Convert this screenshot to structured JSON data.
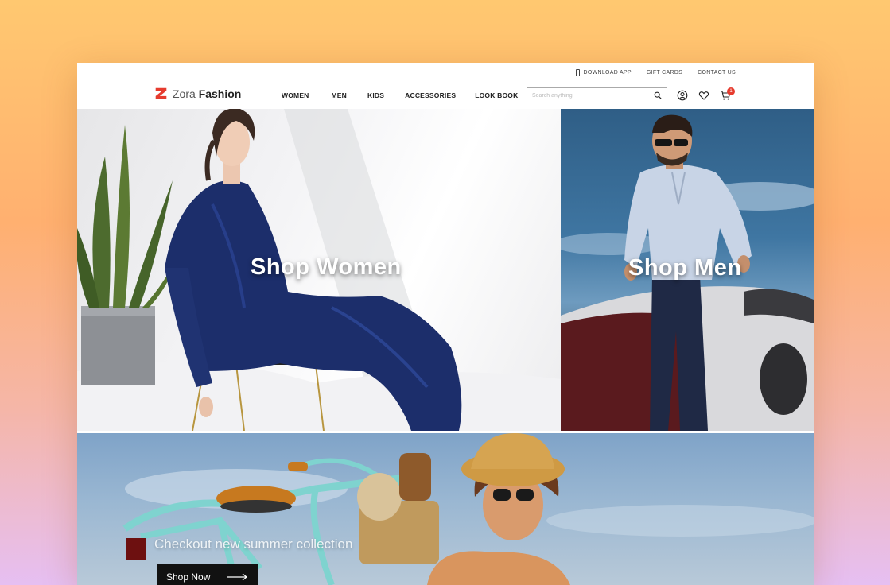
{
  "utility": {
    "download_app": "DOWNLOAD APP",
    "gift_cards": "GIFT CARDS",
    "contact_us": "CONTACT US"
  },
  "logo": {
    "light": "Zora",
    "bold": "Fashion"
  },
  "nav": {
    "women": "WOMEN",
    "men": "MEN",
    "kids": "KIDS",
    "accessories": "ACCESSORIES",
    "look_book": "LOOK BOOK"
  },
  "search": {
    "placeholder": "Search anything"
  },
  "cart": {
    "count": "1"
  },
  "hero": {
    "women_title": "Shop Women",
    "men_title": "Shop Men",
    "summer_text": "Checkout new summer collection",
    "shop_now": "Shop Now"
  },
  "colors": {
    "accent": "#e63b2e",
    "text": "#222222",
    "button_bg": "#111111"
  },
  "icons": [
    "phone-icon",
    "logo-mark-icon",
    "search-icon",
    "user-icon",
    "heart-icon",
    "cart-icon",
    "arrow-right-icon"
  ]
}
